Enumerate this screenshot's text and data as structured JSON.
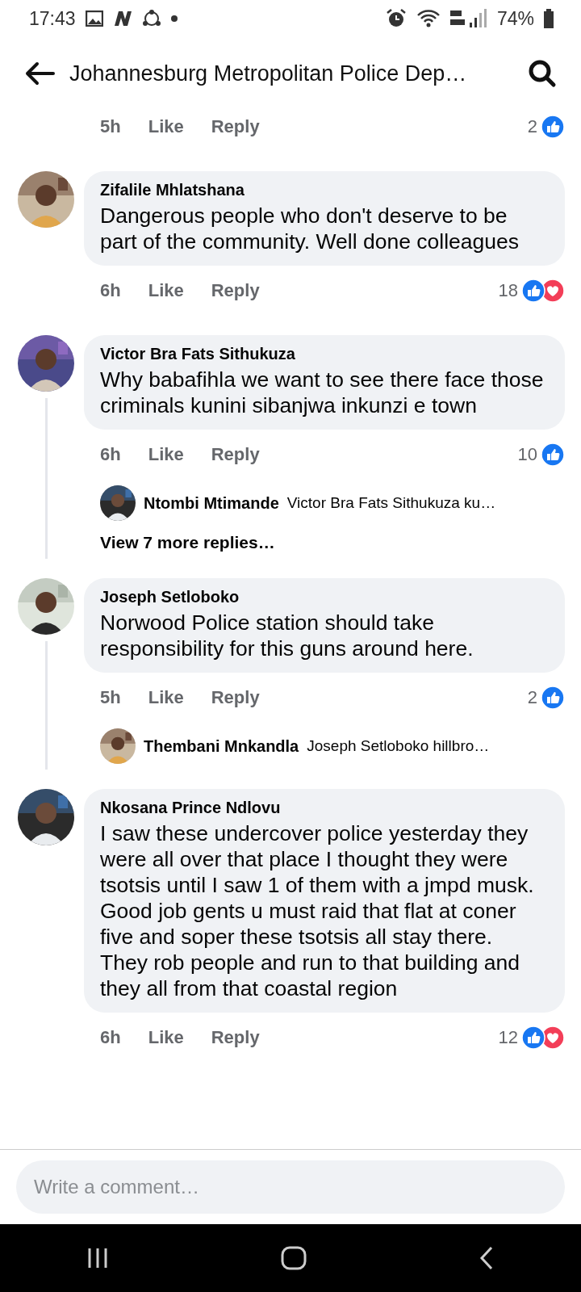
{
  "status_bar": {
    "time": "17:43",
    "battery": "74%"
  },
  "header": {
    "title": "Johannesburg Metropolitan Police Dep…"
  },
  "partial_row": {
    "time": "5h",
    "like": "Like",
    "reply": "Reply",
    "count": "2",
    "reactions": [
      {
        "kind": "like"
      }
    ]
  },
  "comments": [
    {
      "name": "Zifalile Mhlatshana",
      "text": "Dangerous people who don't deserve to be part of the community. Well done colleagues",
      "time": "6h",
      "like": "Like",
      "reply": "Reply",
      "count": "18",
      "reactions": [
        {
          "kind": "like"
        },
        {
          "kind": "love"
        }
      ]
    },
    {
      "name": "Victor Bra Fats Sithukuza",
      "text": "Why babafihla we want to see there face those criminals kunini sibanjwa inkunzi e town",
      "time": "6h",
      "like": "Like",
      "reply": "Reply",
      "count": "10",
      "reactions": [
        {
          "kind": "like"
        }
      ],
      "replies": [
        {
          "name": "Ntombi Mtimande",
          "text": "Victor Bra Fats Sithukuza ku…"
        }
      ],
      "more_replies": "View 7 more replies…"
    },
    {
      "name": "Joseph Setloboko",
      "text": "Norwood Police station should take responsibility for this guns around here.",
      "time": "5h",
      "like": "Like",
      "reply": "Reply",
      "count": "2",
      "reactions": [
        {
          "kind": "like"
        }
      ],
      "replies": [
        {
          "name": "Thembani Mnkandla",
          "text": "Joseph Setloboko hillbro…"
        }
      ]
    },
    {
      "name": "Nkosana Prince Ndlovu",
      "text": "I saw these undercover police yesterday they were all over that place I thought they were tsotsis until I saw 1 of them with a jmpd musk.\nGood job gents u must raid that flat at coner five and soper these tsotsis all stay there.\nThey rob people and run to that building and they all from that coastal region",
      "time": "6h",
      "like": "Like",
      "reply": "Reply",
      "count": "12",
      "reactions": [
        {
          "kind": "like"
        },
        {
          "kind": "love"
        }
      ]
    }
  ],
  "composer": {
    "placeholder": "Write a comment…"
  }
}
